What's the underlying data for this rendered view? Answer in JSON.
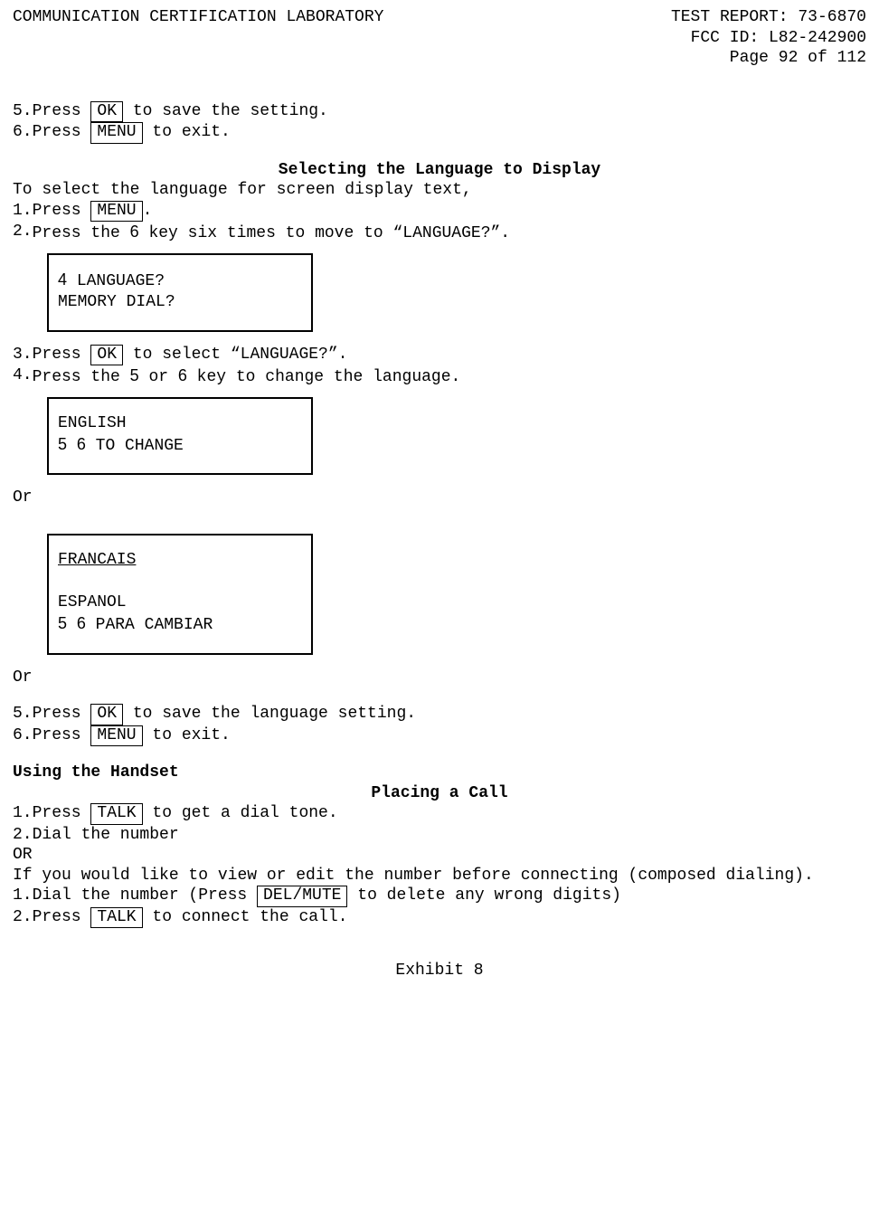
{
  "header": {
    "left": "COMMUNICATION CERTIFICATION LABORATORY",
    "right1": "TEST REPORT: 73-6870",
    "right2": "FCC ID: L82-242900",
    "right3": "Page 92 of 112"
  },
  "keys": {
    "ok": "OK",
    "menu": "MENU",
    "talk": "TALK",
    "delmute": "DEL/MUTE"
  },
  "digits": {
    "four": "4",
    "five": "5",
    "six": "6"
  },
  "intro_steps": {
    "s5_num": "5.",
    "s5_pre": "Press ",
    "s5_post": " to save the setting.",
    "s6_num": "6.",
    "s6_pre": "Press ",
    "s6_post": " to exit."
  },
  "lang_section": {
    "heading": "Selecting the Language to Display",
    "intro": "To select the language for screen display text,",
    "s1_num": "1.",
    "s1_pre": "Press ",
    "s1_post": ".",
    "s2_num": "2.",
    "s2_pre": "Press the ",
    "s2_post": " key six times to move to “LANGUAGE?”.",
    "disp1_l1_rest": " LANGUAGE?",
    "disp1_l2": "MEMORY DIAL?",
    "s3_num": "3.",
    "s3_pre": "Press ",
    "s3_post": " to select “LANGUAGE?”.",
    "s4_num": "4.",
    "s4_pre": "Press the ",
    "s4_mid": " or ",
    "s4_post": " key to change the language.",
    "disp2_l1": "ENGLISH",
    "disp2_l2_rest": " TO CHANGE",
    "or_label_1": "Or",
    "disp3_l1": "FRANCAIS",
    "disp3_gap": "",
    "disp3_l3": "ESPANOL",
    "disp3_l4_rest": " PARA CAMBIAR",
    "or_label_2": "Or",
    "s5_num": "5.",
    "s5_pre": "Press ",
    "s5_post": " to save the language setting.",
    "s6_num": "6.",
    "s6_pre": "Press ",
    "s6_post": " to exit."
  },
  "handset_section": {
    "heading1": "Using the Handset",
    "heading2": "Placing a Call",
    "s1_num": "1.",
    "s1_pre": "Press ",
    "s1_post": " to get a dial tone.",
    "s2_num": "2.",
    "s2_body": "Dial the number",
    "or_label": "OR",
    "para": "If you would like to view or edit the number before connecting (composed dialing).",
    "a1_num": "1.",
    "a1_pre": "Dial the number (Press ",
    "a1_post": " to delete any wrong digits)",
    "a2_num": "2.",
    "a2_pre": "Press ",
    "a2_post": " to connect the call."
  },
  "footer": {
    "exhibit": "Exhibit 8"
  }
}
